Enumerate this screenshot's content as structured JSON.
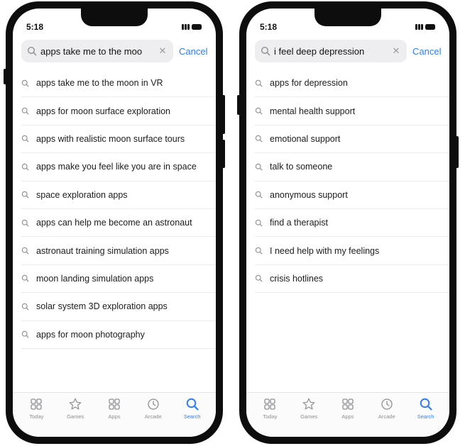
{
  "colors": {
    "accent": "#2f7ef5",
    "inactive": "#8e8e93",
    "field_bg": "#eeeef0"
  },
  "left_phone": {
    "status": {
      "time": "5:18"
    },
    "search": {
      "query": "apps take me to the moo",
      "cancel_label": "Cancel"
    },
    "suggestions": [
      {
        "label": "apps take me to the moon in VR"
      },
      {
        "label": "apps for moon surface exploration"
      },
      {
        "label": "apps with realistic moon surface tours"
      },
      {
        "label": "apps make you feel like you are in space"
      },
      {
        "label": "space exploration apps"
      },
      {
        "label": "apps can help me become an astronaut"
      },
      {
        "label": "astronaut training simulation apps"
      },
      {
        "label": "moon landing simulation apps"
      },
      {
        "label": "solar system 3D exploration apps"
      },
      {
        "label": "apps for moon photography"
      }
    ],
    "tabs": [
      {
        "label": "Today",
        "icon": "today-icon"
      },
      {
        "label": "Games",
        "icon": "star-icon"
      },
      {
        "label": "Apps",
        "icon": "apps-grid-icon"
      },
      {
        "label": "Arcade",
        "icon": "arcade-icon"
      },
      {
        "label": "Search",
        "icon": "search-icon",
        "active": true
      }
    ]
  },
  "right_phone": {
    "status": {
      "time": "5:18"
    },
    "search": {
      "query": "i feel deep depression",
      "cancel_label": "Cancel"
    },
    "suggestions": [
      {
        "label": "apps for depression"
      },
      {
        "label": "mental health support"
      },
      {
        "label": "emotional support"
      },
      {
        "label": "talk to someone"
      },
      {
        "label": "anonymous support"
      },
      {
        "label": "find a therapist"
      },
      {
        "label": "I need help with my feelings"
      },
      {
        "label": "crisis hotlines"
      }
    ],
    "tabs": [
      {
        "label": "Today",
        "icon": "today-icon"
      },
      {
        "label": "Games",
        "icon": "star-icon"
      },
      {
        "label": "Apps",
        "icon": "apps-grid-icon"
      },
      {
        "label": "Arcade",
        "icon": "arcade-icon"
      },
      {
        "label": "Search",
        "icon": "search-icon",
        "active": true
      }
    ]
  }
}
